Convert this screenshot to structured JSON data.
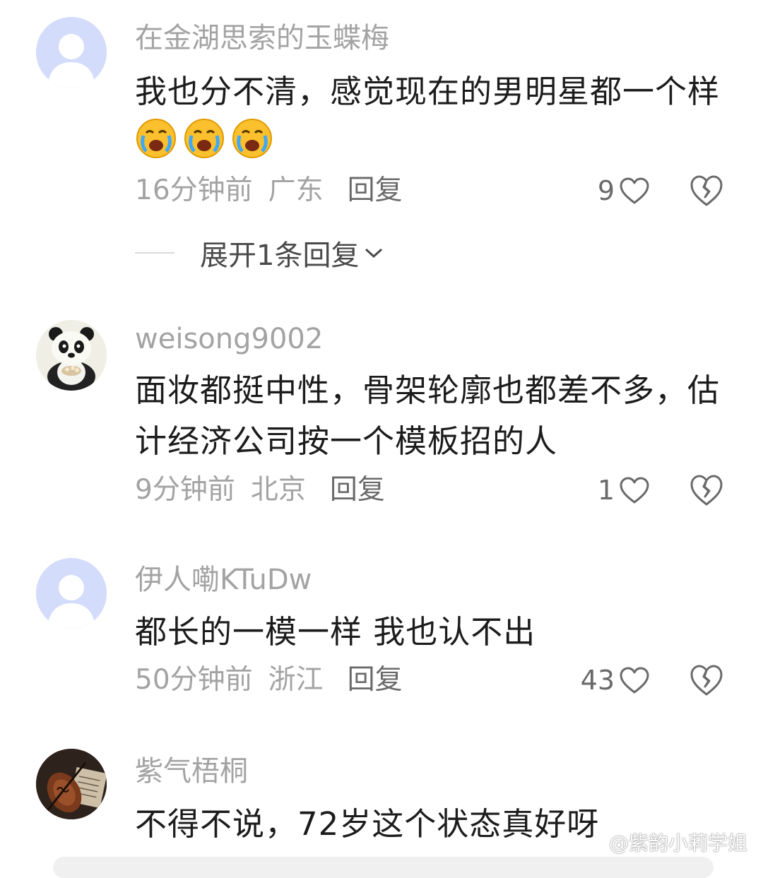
{
  "comments": [
    {
      "username": "在金湖思索的玉蝶梅",
      "text": "我也分不清，感觉现在的男明星都一个样",
      "time": "16分钟前",
      "location": "广东",
      "reply": "回复",
      "likes": "9",
      "avatar": "default-avatar",
      "emojis": [
        "crying-face-emoji",
        "crying-face-emoji",
        "crying-face-emoji"
      ]
    },
    {
      "username": "weisong9002",
      "text": "面妆都挺中性，骨架轮廓也都差不多，估计经济公司按一个模板招的人",
      "time": "9分钟前",
      "location": "北京",
      "reply": "回复",
      "likes": "1",
      "avatar": "panda-avatar"
    },
    {
      "username": "伊人嘞KTuDw",
      "text": "都长的一模一样 我也认不出",
      "time": "50分钟前",
      "location": "浙江",
      "reply": "回复",
      "likes": "43",
      "avatar": "default-avatar"
    },
    {
      "username": "紫气梧桐",
      "text": "不得不说，72岁这个状态真好呀",
      "avatar": "violin-avatar"
    }
  ],
  "expand_replies": "展开1条回复",
  "watermark": "@紫韵小莉学姐",
  "colors": {
    "meta_gray": "#a3a3a3",
    "default_avatar_bg": "#d4dcfb"
  }
}
